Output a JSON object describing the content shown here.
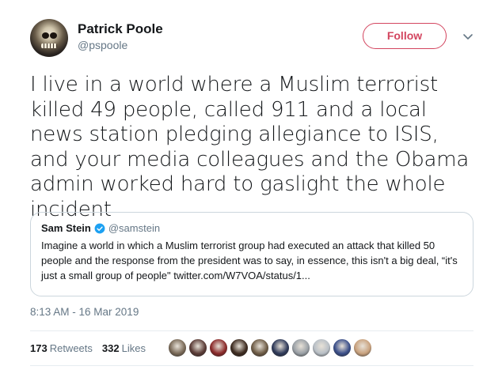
{
  "author": {
    "display_name": "Patrick Poole",
    "handle": "@pspoole",
    "avatar_icon": "avatar-skull-puppet"
  },
  "actions": {
    "follow_label": "Follow",
    "accent": "#d3455f"
  },
  "tweet": {
    "text": "I live in a world where a Muslim terrorist killed 49 people, called 911 and a local news station pledging allegiance to ISIS, and your media colleagues and the Obama admin worked hard to gaslight the whole incident",
    "timestamp": "8:13 AM - 16 Mar 2019"
  },
  "quoted_tweet": {
    "display_name": "Sam Stein",
    "handle": "@samstein",
    "verified_icon": "verified-badge-icon",
    "verified_color": "#1da1f2",
    "text": "Imagine a world in which a Muslim terrorist group had executed an attack that killed 50 people and the response from the president was to say, in essence, this isn't a big deal, “it's just a small group of people\" twitter.com/W7VOA/status/1..."
  },
  "stats": {
    "retweets_count": "173",
    "retweets_label": "Retweets",
    "likes_count": "332",
    "likes_label": "Likes"
  },
  "likers": [
    {
      "name": "liker-1",
      "color": "#7a6a58"
    },
    {
      "name": "liker-2",
      "color": "#5a3b36"
    },
    {
      "name": "liker-3",
      "color": "#8b2a2a"
    },
    {
      "name": "liker-4",
      "color": "#3d2b20"
    },
    {
      "name": "liker-5",
      "color": "#6e5c46"
    },
    {
      "name": "liker-6",
      "color": "#2f3a5a"
    },
    {
      "name": "liker-7",
      "color": "#9aa0a6"
    },
    {
      "name": "liker-8",
      "color": "#b8bfc6"
    },
    {
      "name": "liker-9",
      "color": "#3b4f8a"
    },
    {
      "name": "liker-10",
      "color": "#c9a27e"
    }
  ]
}
